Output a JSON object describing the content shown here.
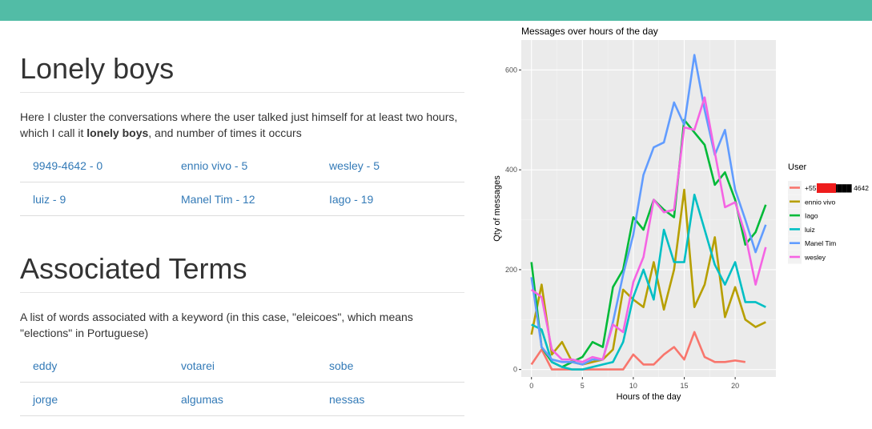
{
  "sections": [
    {
      "title": "Lonely boys",
      "desc_parts": [
        "Here I cluster the conversations where the user talked just himself for at least two hours, which I call it ",
        "lonely boys",
        ", and number of times it occurs"
      ],
      "rows": [
        [
          "9949-4642 - 0",
          "ennio vivo - 5",
          "wesley - 5"
        ],
        [
          "luiz - 9",
          "Manel Tim - 12",
          "Iago - 19"
        ]
      ]
    },
    {
      "title": "Associated Terms",
      "desc_parts": [
        "A list of words associated with a keyword (in this case, \"eleicoes\", which means \"elections\" in Portuguese)",
        "",
        ""
      ],
      "rows": [
        [
          "eddy",
          "votarei",
          "sobe"
        ],
        [
          "jorge",
          "algumas",
          "nessas"
        ]
      ]
    }
  ],
  "chart_data": {
    "type": "line",
    "title": "Messages over hours of the day",
    "xlabel": "Hours of the day",
    "ylabel": "Qty of messages",
    "xlim": [
      -1,
      24
    ],
    "ylim": [
      -15,
      660
    ],
    "xticks": [
      0,
      5,
      10,
      15,
      20
    ],
    "yticks": [
      0,
      200,
      400,
      600
    ],
    "grid": true,
    "legend_title": "User",
    "legend_position": "right",
    "series": [
      {
        "name": "+55 86 █████ 4642",
        "color": "#f8766d",
        "x": [
          0,
          1,
          2,
          3,
          4,
          5,
          6,
          7,
          8,
          9,
          10,
          11,
          12,
          13,
          14,
          15,
          16,
          17,
          18,
          19,
          20,
          21
        ],
        "y": [
          10,
          40,
          0,
          0,
          0,
          0,
          0,
          0,
          0,
          0,
          30,
          10,
          10,
          30,
          45,
          20,
          75,
          25,
          15,
          15,
          18,
          15
        ]
      },
      {
        "name": "ennio vivo",
        "color": "#b79f00",
        "x": [
          0,
          1,
          2,
          3,
          4,
          5,
          6,
          7,
          8,
          9,
          10,
          11,
          12,
          13,
          14,
          15,
          16,
          17,
          18,
          19,
          20,
          21,
          22,
          23
        ],
        "y": [
          70,
          170,
          30,
          55,
          15,
          10,
          15,
          20,
          40,
          160,
          140,
          125,
          215,
          120,
          200,
          360,
          125,
          170,
          265,
          105,
          165,
          100,
          85,
          95
        ]
      },
      {
        "name": "Iago",
        "color": "#00ba38",
        "x": [
          0,
          1,
          2,
          3,
          4,
          5,
          6,
          7,
          8,
          9,
          10,
          11,
          12,
          13,
          14,
          15,
          16,
          17,
          18,
          19,
          20,
          21,
          22,
          23
        ],
        "y": [
          215,
          45,
          15,
          5,
          15,
          25,
          55,
          45,
          165,
          200,
          305,
          280,
          340,
          320,
          305,
          500,
          475,
          450,
          370,
          395,
          340,
          250,
          275,
          330
        ]
      },
      {
        "name": "luiz",
        "color": "#00bfc4",
        "x": [
          0,
          1,
          2,
          3,
          4,
          5,
          6,
          7,
          8,
          9,
          10,
          11,
          12,
          13,
          14,
          15,
          16,
          17,
          18,
          19,
          20,
          21,
          22,
          23
        ],
        "y": [
          90,
          80,
          15,
          5,
          0,
          0,
          5,
          10,
          15,
          55,
          145,
          200,
          140,
          280,
          215,
          215,
          350,
          280,
          210,
          170,
          215,
          135,
          135,
          125
        ]
      },
      {
        "name": "Manel Tim",
        "color": "#619cff",
        "x": [
          0,
          1,
          2,
          3,
          4,
          5,
          6,
          7,
          8,
          9,
          10,
          11,
          12,
          13,
          14,
          15,
          16,
          17,
          18,
          19,
          20,
          21,
          22,
          23
        ],
        "y": [
          185,
          45,
          20,
          15,
          15,
          10,
          20,
          20,
          95,
          190,
          270,
          390,
          445,
          455,
          535,
          490,
          630,
          520,
          430,
          480,
          360,
          300,
          235,
          290
        ]
      },
      {
        "name": "wesley",
        "color": "#f564e3",
        "x": [
          0,
          1,
          2,
          3,
          4,
          5,
          6,
          7,
          8,
          9,
          10,
          11,
          12,
          13,
          14,
          15,
          16,
          17,
          18,
          19,
          20,
          21,
          22,
          23
        ],
        "y": [
          160,
          145,
          40,
          20,
          20,
          15,
          25,
          20,
          90,
          75,
          175,
          225,
          340,
          315,
          320,
          485,
          480,
          545,
          435,
          325,
          335,
          270,
          170,
          245
        ]
      }
    ]
  }
}
